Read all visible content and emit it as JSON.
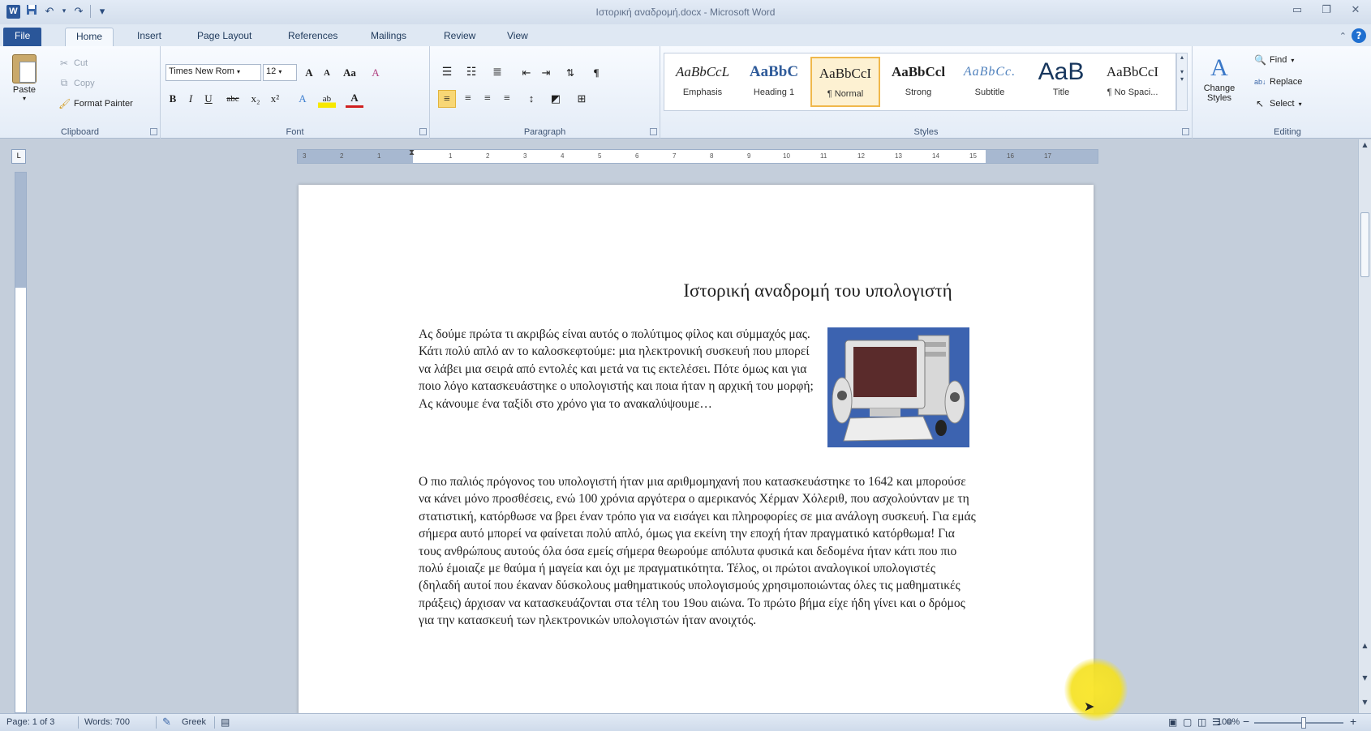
{
  "window": {
    "title": "Ιστορική αναδρομή.docx - Microsoft Word",
    "app_icon": "W"
  },
  "quick_access": {
    "save": "save-icon",
    "undo": "↶",
    "redo": "↷",
    "customize": "▾"
  },
  "tabs": [
    "File",
    "Home",
    "Insert",
    "Page Layout",
    "References",
    "Mailings",
    "Review",
    "View"
  ],
  "ribbon": {
    "clipboard": {
      "label": "Clipboard",
      "paste": "Paste",
      "cut": "Cut",
      "copy": "Copy",
      "format_painter": "Format Painter"
    },
    "font": {
      "label": "Font",
      "font_name": "Times New Rom",
      "font_size": "12",
      "grow": "A",
      "shrink": "A",
      "change_case": "Aa",
      "clear": "A",
      "bold": "B",
      "italic": "I",
      "underline": "U",
      "strike": "abc",
      "subscript": "x₂",
      "superscript": "x²",
      "text_effects": "A",
      "highlight": "ab",
      "font_color": "A"
    },
    "paragraph": {
      "label": "Paragraph",
      "show_marks": "¶"
    },
    "styles": {
      "label": "Styles",
      "items": [
        {
          "sample": "AaBbCcL",
          "name": "Emphasis"
        },
        {
          "sample": "AaBbC",
          "name": "Heading 1"
        },
        {
          "sample": "AaBbCcI",
          "name": "¶ Normal"
        },
        {
          "sample": "AaBbCcl",
          "name": "Strong"
        },
        {
          "sample": "AaBbCc.",
          "name": "Subtitle"
        },
        {
          "sample": "AaB",
          "name": "Title"
        },
        {
          "sample": "AaBbCcI",
          "name": "¶ No Spaci..."
        }
      ],
      "change_styles": "Change Styles"
    },
    "editing": {
      "label": "Editing",
      "find": "Find",
      "replace": "Replace",
      "select": "Select"
    }
  },
  "ruler": {
    "ticks": [
      "3",
      "2",
      "1",
      "1",
      "2",
      "3",
      "4",
      "5",
      "6",
      "7",
      "8",
      "9",
      "10",
      "11",
      "12",
      "13",
      "14",
      "15",
      "16",
      "17"
    ]
  },
  "document": {
    "title": "Ιστορική αναδρομή του υπολογιστή",
    "paragraph1": "Ας δούμε πρώτα τι ακριβώς είναι αυτός ο πολύτιμος φίλος και σύμμαχός μας. Κάτι πολύ απλό αν το καλοσκεφτούμε: μια ηλεκτρονική συσκευή που μπορεί να λάβει μια σειρά από εντολές και μετά να τις εκτελέσει. Πότε όμως και για ποιο λόγο κατασκευάστηκε ο υπολογιστής και ποια ήταν η αρχική του μορφή; Ας κάνουμε ένα ταξίδι στο χρόνο για το ανακαλύψουμε…",
    "paragraph2": "Ο πιο παλιός πρόγονος του υπολογιστή ήταν μια αριθμομηχανή που κατασκευάστηκε το 1642 και μπορούσε να κάνει μόνο προσθέσεις, ενώ 100 χρόνια αργότερα ο αμερικανός Χέρμαν Χόλεριθ, που ασχολούνταν με τη στατιστική, κατόρθωσε να βρει έναν τρόπο για να εισάγει και πληροφορίες σε μια ανάλογη συσκευή. Για εμάς σήμερα αυτό μπορεί να φαίνεται πολύ απλό, όμως για εκείνη την εποχή ήταν πραγματικό κατόρθωμα! Για τους ανθρώπους αυτούς όλα όσα εμείς σήμερα θεωρούμε απόλυτα φυσικά και δεδομένα ήταν κάτι που πιο πολύ έμοιαζε με θαύμα ή μαγεία και όχι με πραγματικότητα.  Τέλος, οι πρώτοι αναλογικοί υπολογιστές (δηλαδή αυτοί που έκαναν δύσκολους μαθηματικούς υπολογισμούς χρησιμοποιώντας όλες τις μαθηματικές πράξεις) άρχισαν να κατασκευάζονται στα τέλη του 19ου αιώνα. Το πρώτο βήμα είχε ήδη γίνει και ο δρόμος για την κατασκευή των ηλεκτρονικών υπολογιστών ήταν ανοιχτός."
  },
  "status": {
    "page": "Page: 1 of 3",
    "words": "Words: 700",
    "language": "Greek",
    "zoom": "100%",
    "zoom_out": "−",
    "zoom_in": "+"
  }
}
